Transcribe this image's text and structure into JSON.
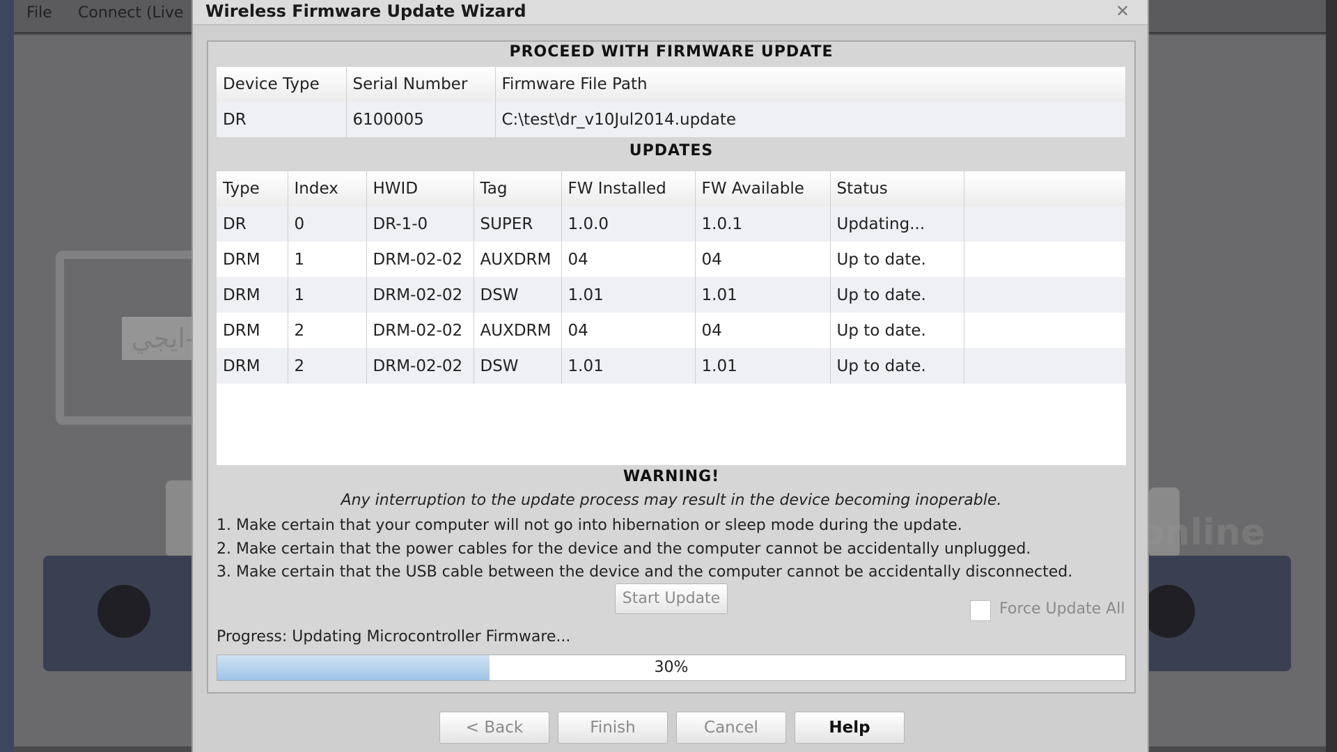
{
  "app": {
    "menu": [
      "File",
      "Connect (Live"
    ],
    "watermark_small": "ماي-ايجي",
    "watermark_url": "my-egy.online"
  },
  "dialog": {
    "title": "Wireless Firmware Update Wizard",
    "close_icon": "close-icon",
    "proceed_title": "PROCEED WITH FIRMWARE UPDATE",
    "device_table": {
      "headers": [
        "Device Type",
        "Serial Number",
        "Firmware File Path"
      ],
      "row": [
        "DR",
        "6100005",
        "C:\\test\\dr_v10Jul2014.update"
      ]
    },
    "updates_title": "UPDATES",
    "updates_table": {
      "headers": [
        "Type",
        "Index",
        "HWID",
        "Tag",
        "FW Installed",
        "FW Available",
        "Status",
        ""
      ],
      "rows": [
        [
          "DR",
          "0",
          "DR-1-0",
          "SUPER",
          "1.0.0",
          "1.0.1",
          "Updating..."
        ],
        [
          "DRM",
          "1",
          "DRM-02-02",
          "AUXDRM",
          "04",
          "04",
          "Up to date."
        ],
        [
          "DRM",
          "1",
          "DRM-02-02",
          "DSW",
          "1.01",
          "1.01",
          "Up to date."
        ],
        [
          "DRM",
          "2",
          "DRM-02-02",
          "AUXDRM",
          "04",
          "04",
          "Up to date."
        ],
        [
          "DRM",
          "2",
          "DRM-02-02",
          "DSW",
          "1.01",
          "1.01",
          "Up to date."
        ]
      ]
    },
    "warning": {
      "title": "WARNING!",
      "subtitle": "Any interruption to the update process may result in the device becoming inoperable.",
      "lines": [
        "1. Make certain that your computer will not go into hibernation or sleep mode during the update.",
        "2. Make certain that the power cables for the device and the computer cannot be accidentally unplugged.",
        "3. Make certain that the USB cable between the device and the computer cannot be accidentally disconnected."
      ]
    },
    "start_update_label": "Start Update",
    "force_update_label": "Force Update All",
    "force_update_checked": false,
    "progress": {
      "text": "Progress: Updating Microcontroller Firmware...",
      "percent": 30,
      "label": "30%"
    },
    "buttons": {
      "back": "< Back",
      "finish": "Finish",
      "cancel": "Cancel",
      "help": "Help"
    }
  },
  "colors": {
    "dialog_bg": "#cfcfcf",
    "progress_fill": "#9ec3e6",
    "app_bg": "#4a4a4c"
  }
}
